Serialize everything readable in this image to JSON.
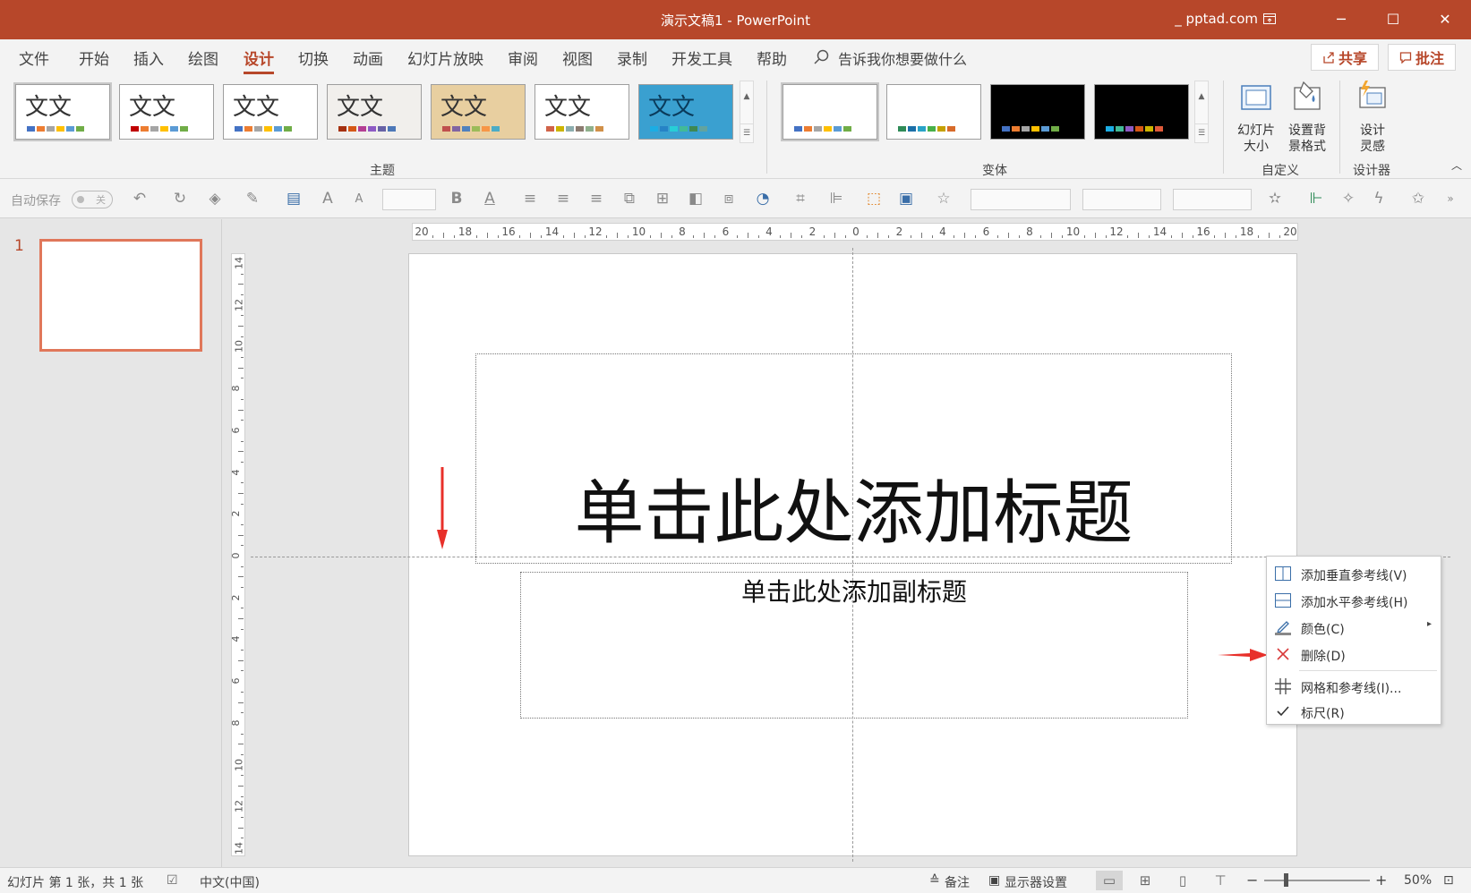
{
  "window": {
    "title": "演示文稿1  -  PowerPoint",
    "account": "_ pptad.com",
    "buttons": {
      "ribbon_display": "⊡",
      "minimize": "─",
      "maximize": "☐",
      "close": "✕"
    }
  },
  "menu": {
    "tabs": [
      "文件",
      "开始",
      "插入",
      "绘图",
      "设计",
      "切换",
      "动画",
      "幻灯片放映",
      "审阅",
      "视图",
      "录制",
      "开发工具",
      "帮助"
    ],
    "active_tab": "设计",
    "tell_me": "告诉我你想要做什么",
    "share": "共享",
    "comments": "批注"
  },
  "ribbon": {
    "themes_label": "主题",
    "theme_text": "文文",
    "themes": [
      {
        "name": "office-theme",
        "bg": "#ffffff",
        "colors": [
          "#4472c4",
          "#ed7d31",
          "#a5a5a5",
          "#ffc000",
          "#5b9bd5",
          "#70ad47"
        ]
      },
      {
        "name": "office-2013-theme",
        "bg": "#ffffff",
        "colors": [
          "#c00000",
          "#ed7d31",
          "#a5a5a5",
          "#ffc000",
          "#5b9bd5",
          "#70ad47"
        ]
      },
      {
        "name": "theme-3",
        "bg": "#ffffff",
        "colors": [
          "#4472c4",
          "#ed7d31",
          "#a5a5a5",
          "#ffc000",
          "#5b9bd5",
          "#70ad47"
        ]
      },
      {
        "name": "theme-4",
        "bg": "#f1efec",
        "colors": [
          "#a5300f",
          "#d55816",
          "#b43e93",
          "#8d5ac4",
          "#6762a6",
          "#4d78b8"
        ]
      },
      {
        "name": "theme-5",
        "bg": "#e8cfa0",
        "colors": [
          "#c0504d",
          "#8064a2",
          "#4f81bd",
          "#9bbb59",
          "#f79646",
          "#4bacc6"
        ]
      },
      {
        "name": "theme-6",
        "bg": "#ffffff",
        "colors": [
          "#d16349",
          "#ccb400",
          "#8cadae",
          "#8c7b70",
          "#8fb08c",
          "#d19049"
        ]
      },
      {
        "name": "theme-7",
        "bg": "#3aa0d0",
        "colors": [
          "#1cade4",
          "#2683c6",
          "#27ced7",
          "#42ba97",
          "#3e8853",
          "#62a39f"
        ]
      }
    ],
    "variants_label": "变体",
    "variants": [
      {
        "name": "variant-1",
        "bg": "#ffffff",
        "colors": [
          "#4472c4",
          "#ed7d31",
          "#a5a5a5",
          "#ffc000",
          "#5b9bd5",
          "#70ad47"
        ]
      },
      {
        "name": "variant-2",
        "bg": "#ffffff",
        "colors": [
          "#2e8b57",
          "#1b6fa8",
          "#29a3c7",
          "#48b048",
          "#c5a000",
          "#d86b2a"
        ]
      },
      {
        "name": "variant-3",
        "bg": "#000000",
        "colors": [
          "#4472c4",
          "#ed7d31",
          "#a5a5a5",
          "#ffc000",
          "#5b9bd5",
          "#70ad47"
        ]
      },
      {
        "name": "variant-4",
        "bg": "#000000",
        "colors": [
          "#1cade4",
          "#42ba97",
          "#8d5ac4",
          "#d55816",
          "#ccb400",
          "#e05a3a"
        ]
      }
    ],
    "customize_label": "自定义",
    "slide_size": "幻灯片\n大小",
    "format_bg": "设置背\n景格式",
    "designer_label": "设计器",
    "design_ideas": "设计\n灵感"
  },
  "qat": {
    "autosave": "自动保存",
    "toggle": "关"
  },
  "thumbnails": {
    "slide_number": "1"
  },
  "slide": {
    "title_placeholder": "单击此处添加标题",
    "subtitle_placeholder": "单击此处添加副标题"
  },
  "ruler": {
    "h_labels": [
      "20",
      "18",
      "16",
      "14",
      "12",
      "10",
      "8",
      "6",
      "4",
      "2",
      "0",
      "2",
      "4",
      "6",
      "8",
      "10",
      "12",
      "14",
      "16",
      "18",
      "20"
    ],
    "v_labels": [
      "14",
      "12",
      "10",
      "8",
      "6",
      "4",
      "2",
      "0",
      "2",
      "4",
      "6",
      "8",
      "10",
      "12",
      "14"
    ]
  },
  "context_menu": {
    "items": [
      {
        "label": "添加垂直参考线(V)",
        "icon": "vertical-guide-icon"
      },
      {
        "label": "添加水平参考线(H)",
        "icon": "horizontal-guide-icon"
      },
      {
        "label": "颜色(C)",
        "icon": "pen-color-icon",
        "submenu": "▸"
      },
      {
        "label": "删除(D)",
        "icon": "delete-x-icon"
      },
      {
        "label": "网格和参考线(I)...",
        "icon": "grid-icon"
      },
      {
        "label": "标尺(R)",
        "icon": "check-icon"
      }
    ]
  },
  "status": {
    "slide_info": "幻灯片 第 1 张，共 1 张",
    "language": "中文(中国)",
    "notes": "备注",
    "display_settings": "显示器设置",
    "zoom": "50%",
    "zoom_minus": "−",
    "zoom_plus": "+"
  },
  "colors": {
    "brand": "#b7472a",
    "annotation_arrow": "#e8302a"
  }
}
